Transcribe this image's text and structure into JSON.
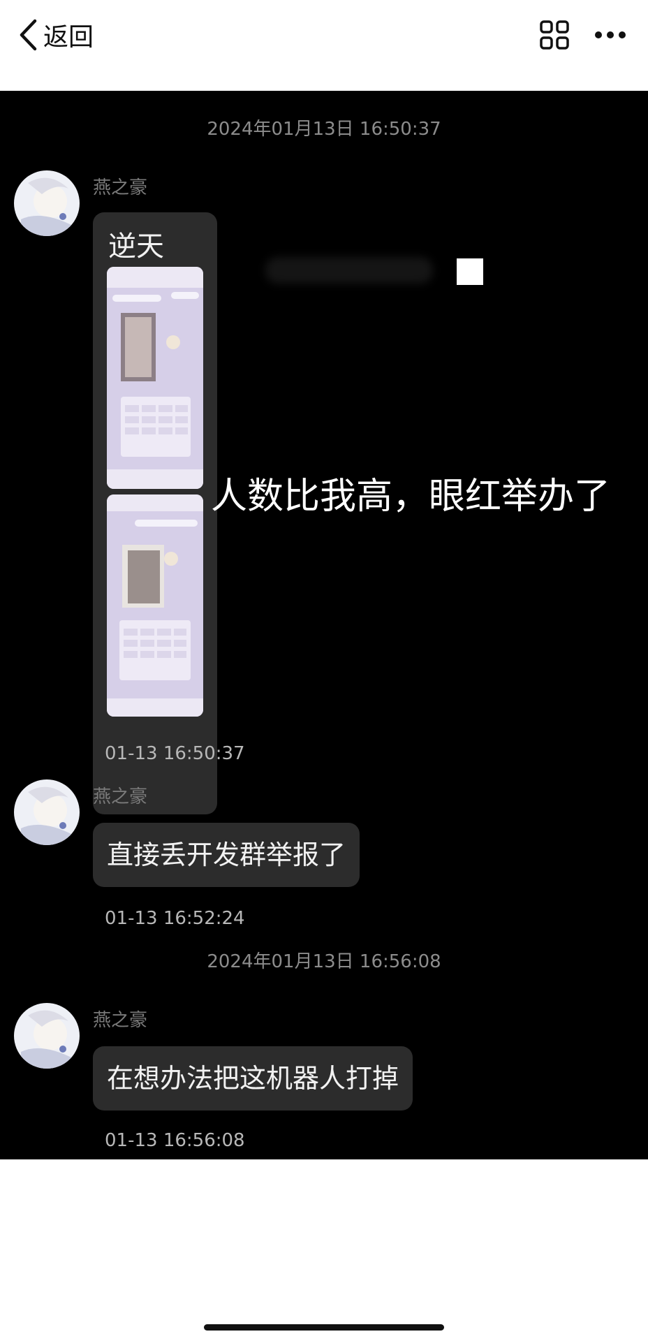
{
  "nav": {
    "back_label": "返回",
    "icons": [
      "back-chevron-icon",
      "grid-icon",
      "more-dots-icon"
    ]
  },
  "chat": {
    "timestamp_1": "2024年01月13日 16:50:37",
    "timestamp_2": "2024年01月13日 16:56:08",
    "messages": [
      {
        "sender": "燕之豪",
        "caption": "逆天",
        "overlay_text": "人数比我高，眼红举办了",
        "time": "01-13 16:50:37"
      },
      {
        "sender": "燕之豪",
        "text": "直接丢开发群举报了",
        "time": "01-13 16:52:24"
      },
      {
        "sender": "燕之豪",
        "text": "在想办法把这机器人打掉",
        "time": "01-13 16:56:08"
      }
    ]
  },
  "colors": {
    "chat_background": "#000000",
    "bubble": "#2c2c2c",
    "bubble_text": "#f2f2f2",
    "meta_text": "#8c8c8c"
  }
}
